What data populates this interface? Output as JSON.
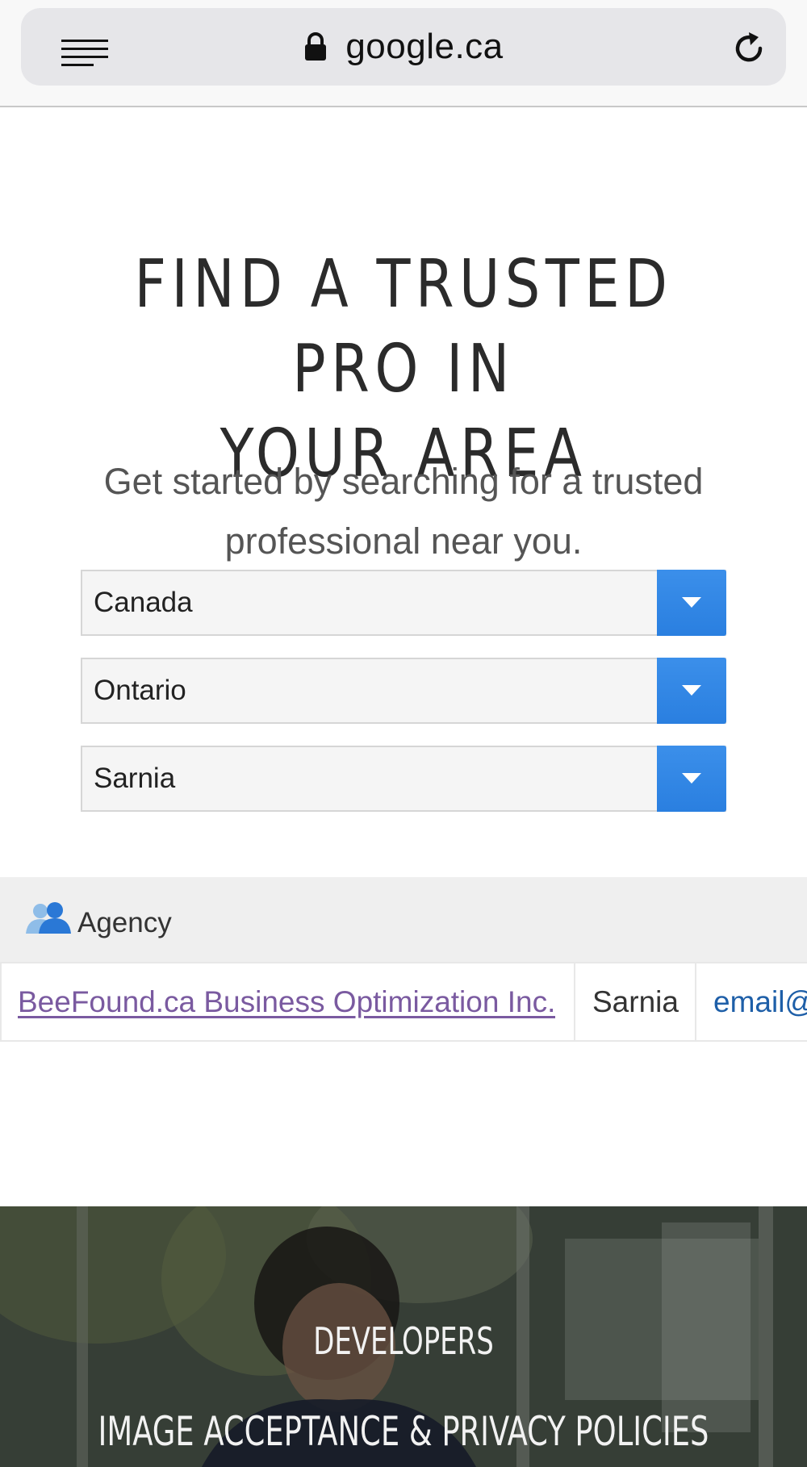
{
  "browser": {
    "url": "google.ca",
    "icons": [
      "menu-icon",
      "lock-icon",
      "reload-icon"
    ]
  },
  "hero": {
    "title_line1": "FIND A TRUSTED PRO IN",
    "title_line2": "YOUR AREA",
    "subtitle_line1": "Get started by searching for a trusted",
    "subtitle_line2": "professional near you."
  },
  "filters": {
    "country": "Canada",
    "province": "Ontario",
    "city": "Sarnia"
  },
  "results": {
    "header_label": "Agency",
    "header_icon": "users-icon",
    "rows": [
      {
        "company": "BeeFound.ca Business Optimization Inc.",
        "city": "Sarnia",
        "email": "email@"
      }
    ]
  },
  "footer": {
    "developers": "DEVELOPERS",
    "policies": "IMAGE ACCEPTANCE & PRIVACY POLICIES"
  },
  "colors": {
    "select_arrow_bg": "#2a7fe0",
    "visited_link": "#7a5aa0",
    "email_link": "#1e5fa8"
  }
}
